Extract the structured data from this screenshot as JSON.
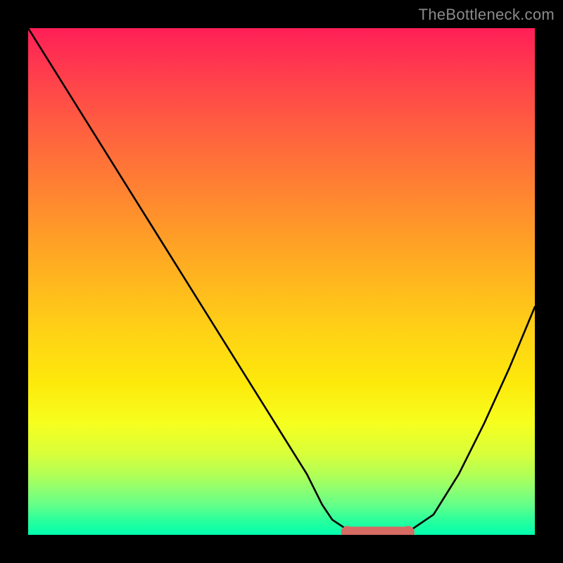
{
  "attribution": "TheBottleneck.com",
  "chart_data": {
    "type": "line",
    "title": "",
    "xlabel": "",
    "ylabel": "",
    "xlim": [
      0,
      100
    ],
    "ylim": [
      0,
      100
    ],
    "x": [
      0,
      5,
      10,
      15,
      20,
      25,
      30,
      35,
      40,
      45,
      50,
      55,
      58,
      60,
      63,
      66,
      69,
      72,
      75,
      80,
      85,
      90,
      95,
      100
    ],
    "values": [
      100,
      92,
      84,
      76,
      68,
      60,
      52,
      44,
      36,
      28,
      20,
      12,
      6,
      3,
      1,
      0.3,
      0,
      0.2,
      0.6,
      4,
      12,
      22,
      33,
      45
    ],
    "flat_bottom": {
      "x_start": 63,
      "x_end": 75,
      "y": 0.5
    },
    "marker_color": "#d66b63",
    "line_color": "#000000",
    "gradient_stops": [
      {
        "pos": 0,
        "color": "#ff1f57"
      },
      {
        "pos": 50,
        "color": "#ffb71e"
      },
      {
        "pos": 78,
        "color": "#f6ff1f"
      },
      {
        "pos": 100,
        "color": "#00ffae"
      }
    ]
  }
}
